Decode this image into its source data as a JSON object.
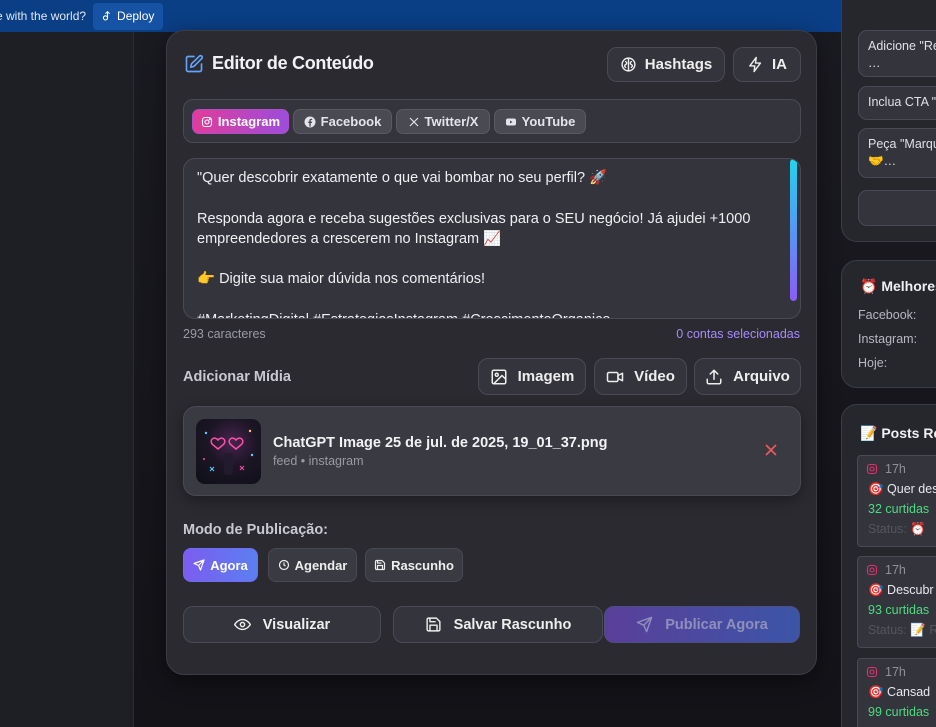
{
  "topbar": {
    "share_text": "e with the world?",
    "deploy_label": "Deploy"
  },
  "editor": {
    "title": "Editor de Conteúdo",
    "hashtags_label": "Hashtags",
    "ai_label": "IA",
    "platforms": [
      {
        "label": "Instagram",
        "active": true
      },
      {
        "label": "Facebook",
        "active": false
      },
      {
        "label": "Twitter/X",
        "active": false
      },
      {
        "label": "YouTube",
        "active": false
      }
    ],
    "content": "\"Quer descobrir exatamente o que vai bombar no seu perfil? 🚀\n\nResponda agora e receba sugestões exclusivas para o SEU negócio! Já ajudei +1000 empreendedores a crescerem no Instagram 📈\n\n👉 Digite sua maior dúvida nos comentários!\n\n#MarketingDigital #EstrategiasInstagram #CrescimentoOrganico",
    "char_count": "293 caracteres",
    "accounts_selected": "0 contas selecionadas",
    "media": {
      "label": "Adicionar Mídia",
      "image_label": "Imagem",
      "video_label": "Vídeo",
      "file_label": "Arquivo",
      "attached": {
        "filename": "ChatGPT Image 25 de jul. de 2025, 19_01_37.png",
        "meta": "feed • instagram"
      }
    },
    "publish_mode": {
      "label": "Modo de Publicação:",
      "now": "Agora",
      "schedule": "Agendar",
      "draft": "Rascunho"
    },
    "actions": {
      "preview": "Visualizar",
      "save_draft": "Salvar Rascunho",
      "publish_now": "Publicar Agora"
    }
  },
  "suggestions": [
    "Adicione \"Re",
    "…",
    "Inclua CTA \"",
    "Peça \"Marqu",
    "🤝…"
  ],
  "best_times": {
    "title": "⏰ Melhores",
    "rows": [
      "Facebook:",
      "Instagram:",
      "Hoje:"
    ]
  },
  "recent_posts": {
    "title": "📝 Posts Re",
    "items": [
      {
        "time": "17h",
        "text": "🎯 Quer des",
        "likes": "32 curtidas",
        "status": "Status: ⏰"
      },
      {
        "time": "17h",
        "text": "🎯 Descubr",
        "likes": "93 curtidas",
        "status": "Status: 📝 R"
      },
      {
        "time": "17h",
        "text": "🎯 Cansad",
        "likes": "99 curtidas",
        "status": ""
      }
    ]
  },
  "colors": {
    "accent_gradient_start": "#e13c9a",
    "accent_gradient_end": "#9c4ddc",
    "mode_active": "#7c5cf0",
    "likes": "#4ade80",
    "remove": "#ef5a5a"
  }
}
